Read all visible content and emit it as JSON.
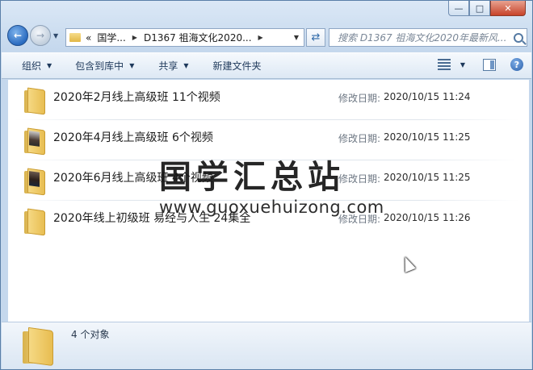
{
  "window": {
    "caption_minimize": "—",
    "caption_maximize": "□",
    "caption_close": "✕"
  },
  "address": {
    "prefix": "«",
    "crumbs": [
      "国学...",
      "D1367 祖海文化2020..."
    ]
  },
  "search": {
    "placeholder": "搜索 D1367 祖海文化2020年最新风..."
  },
  "toolbar": {
    "organize": "组织",
    "include_in_library": "包含到库中",
    "share": "共享",
    "new_folder": "新建文件夹"
  },
  "files": [
    {
      "name": "2020年2月线上高级班 11个视频",
      "meta_label": "修改日期:",
      "modified": "2020/10/15 11:24",
      "thumb": "plain"
    },
    {
      "name": "2020年4月线上高级班 6个视频",
      "meta_label": "修改日期:",
      "modified": "2020/10/15 11:25",
      "thumb": "photo"
    },
    {
      "name": "2020年6月线上高级班 4个视频",
      "meta_label": "修改日期:",
      "modified": "2020/10/15 11:25",
      "thumb": "photo-dark"
    },
    {
      "name": "2020年线上初级班 易经与人生 24集全",
      "meta_label": "修改日期:",
      "modified": "2020/10/15 11:26",
      "thumb": "plain"
    }
  ],
  "watermark": {
    "title": "国学汇总站",
    "url": "www.guoxuehuizong.com"
  },
  "details": {
    "count": "4 个对象"
  }
}
